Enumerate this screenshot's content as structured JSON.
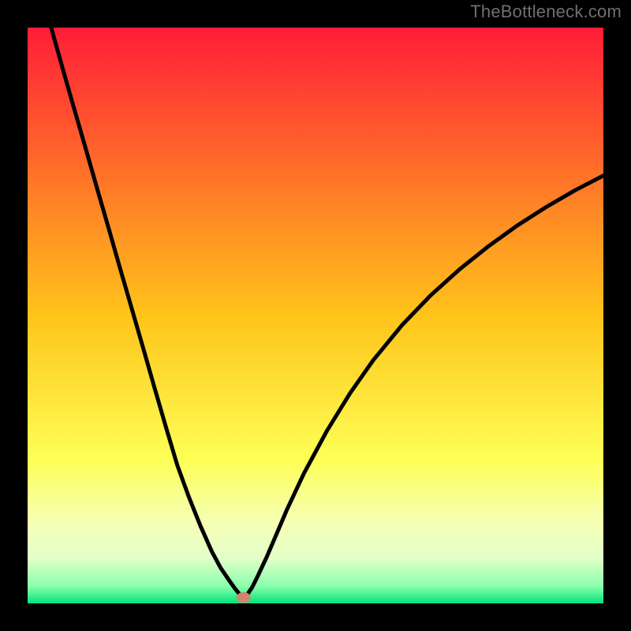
{
  "watermark": "TheBottleneck.com",
  "chart_data": {
    "type": "line",
    "title": "",
    "xlabel": "",
    "ylabel": "",
    "xlim": [
      0,
      100
    ],
    "ylim": [
      0,
      100
    ],
    "background_gradient": {
      "direction": "vertical",
      "stops": [
        {
          "pos": 0.0,
          "color": "#ff1c38"
        },
        {
          "pos": 0.5,
          "color": "#ffc41a"
        },
        {
          "pos": 0.75,
          "color": "#fdff55"
        },
        {
          "pos": 0.86,
          "color": "#f5ffb6"
        },
        {
          "pos": 0.92,
          "color": "#e4ffc8"
        },
        {
          "pos": 0.97,
          "color": "#8cffac"
        },
        {
          "pos": 1.0,
          "color": "#00e37a"
        }
      ]
    },
    "marker": {
      "x": 37.5,
      "y": 1.0,
      "color": "#d1856f"
    },
    "series": [
      {
        "name": "curve",
        "color": "#000000",
        "x": [
          4.1,
          6,
          8,
          10,
          12,
          14,
          16,
          18,
          20,
          22,
          24,
          26,
          28,
          30,
          32,
          33.5,
          35,
          36,
          36.8,
          37.5,
          38.2,
          39,
          40,
          41.5,
          43,
          45,
          48,
          52,
          56,
          60,
          65,
          70,
          75,
          80,
          85,
          90,
          95,
          100
        ],
        "y": [
          100,
          93.2,
          86.2,
          79.3,
          72.3,
          65.4,
          58.4,
          51.5,
          44.6,
          37.6,
          30.7,
          24.0,
          18.5,
          13.5,
          9.0,
          6.2,
          4.0,
          2.6,
          1.6,
          1.0,
          1.6,
          2.8,
          4.8,
          8.0,
          11.5,
          16.2,
          22.6,
          30.0,
          36.5,
          42.2,
          48.3,
          53.5,
          58.0,
          62.0,
          65.6,
          68.8,
          71.7,
          74.3
        ]
      }
    ]
  }
}
